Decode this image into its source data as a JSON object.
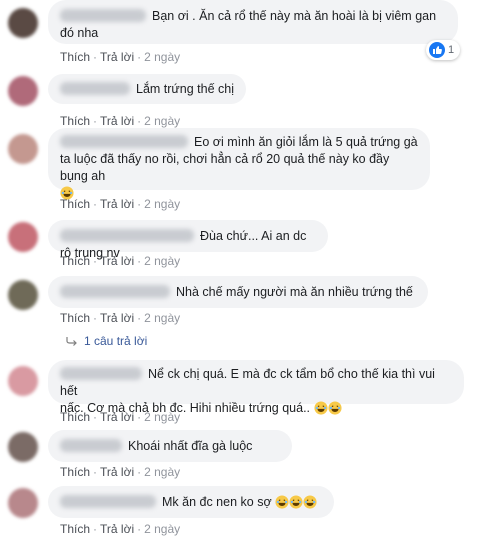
{
  "actions": {
    "like": "Thích",
    "reply": "Trả lời",
    "separator": "·",
    "time": "2 ngày"
  },
  "comments": [
    {
      "text": "Bạn ơi . Ăn cả rổ thế này mà ăn hoài là bị viêm gan đó nha",
      "line1": "Bạn ơi . Ăn cả rổ thế này mà ăn hoài là bị viêm gan",
      "line2": "đó nha",
      "reaction_count": "1"
    },
    {
      "text": "Lắm trứng thế chị"
    },
    {
      "line1": "Eo ơi mình ăn giỏi lắm là 5 quả trứng gà",
      "line2": "ta luộc đã thấy no rồi, chơi hẳn cả rổ 20 quả thế này ko đầy bụng ah"
    },
    {
      "text": "Đùa chứ... Ai an dc rô trung nv"
    },
    {
      "text": "Nhà chế mấy người mà ăn nhiều trứng thế"
    },
    {
      "line1": "Nể ck chị quá. E mà đc ck tẩm bổ cho thế kia thì vui hết",
      "line2": "nấc. Cơ mà chả bh đc. Hihi nhiều trứng quá.."
    },
    {
      "text": "Khoái nhất đĩa gà luộc"
    },
    {
      "text": "Mk ăn đc nen ko sợ"
    }
  ],
  "reply_link": "1 câu trả lời",
  "colors": {
    "bubble": "#f2f3f5",
    "link": "#385898",
    "like_blue": "#1877f2",
    "muted": "#90949c"
  }
}
